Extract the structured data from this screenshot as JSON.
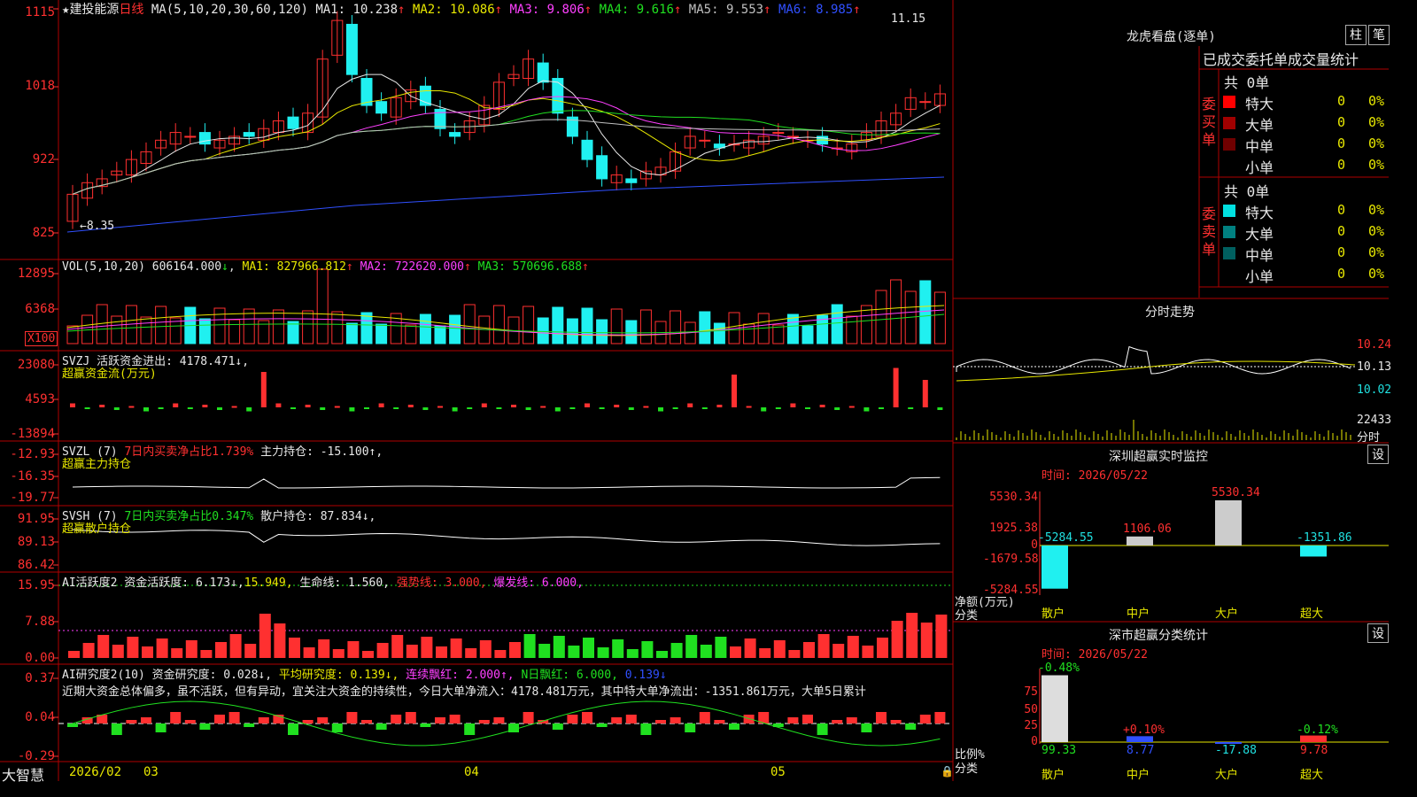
{
  "stock": {
    "name": "建投能源",
    "period": "日线",
    "star": "★"
  },
  "main": {
    "ma_params": "MA(5,10,20,30,60,120)",
    "ma_items": [
      {
        "text": "MA1: 10.238",
        "arrow": "↑",
        "color": "#e8e8e8"
      },
      {
        "text": "MA2: 10.086",
        "arrow": "↑",
        "color": "#e8e800"
      },
      {
        "text": "MA3: 9.806",
        "arrow": "↑",
        "color": "#ff40ff"
      },
      {
        "text": "MA4: 9.616",
        "arrow": "↑",
        "color": "#20e020"
      },
      {
        "text": "MA5: 9.553",
        "arrow": "↑",
        "color": "#c0c0c0"
      },
      {
        "text": "MA6: 8.985",
        "arrow": "↑",
        "color": "#3050ff"
      }
    ],
    "y_labels": [
      "1115",
      "1018",
      "922",
      "825"
    ],
    "high_mark": "11.15",
    "low_mark": "8.35"
  },
  "vol": {
    "label": "VOL(5,10,20)",
    "value": "606164.000",
    "ma_items": [
      {
        "text": "MA1: 827966.812",
        "arrow": "↑",
        "color": "#e8e800"
      },
      {
        "text": "MA2: 722620.000",
        "arrow": "↑",
        "color": "#ff40ff"
      },
      {
        "text": "MA3: 570696.688",
        "arrow": "↑",
        "color": "#20e020"
      }
    ],
    "y_labels": [
      "12895",
      "6368"
    ],
    "unit": "X100"
  },
  "svzj": {
    "line1": "SVZJ  活跃资金进出: 4178.471↓,",
    "line2": "超赢资金流(万元)",
    "y_labels": [
      "23080",
      "4593",
      "-13894"
    ]
  },
  "svzl": {
    "p1": "SVZL (7)",
    "p2": "7日内买卖净占比1.739%",
    "p3": "主力持仓: -15.100↑,",
    "line2": "超赢主力持仓",
    "y_labels": [
      "-12.93",
      "-16.35",
      "-19.77"
    ]
  },
  "svsh": {
    "p1": "SVSH (7)",
    "p2": "7日内买卖净占比0.347%",
    "p3": "散户持仓: 87.834↓,",
    "line2": "超赢散户持仓",
    "y_labels": [
      "91.95",
      "89.13",
      "86.42"
    ]
  },
  "ai_active": {
    "p1": "AI活跃度2 资金活跃度: 6.173↓,",
    "p2": "15.949,",
    "p3": "生命线: 1.560,",
    "p4": "强势线: 3.000,",
    "p5": "爆发线: 6.000,",
    "y_labels": [
      "15.95",
      "7.88",
      "0.00"
    ]
  },
  "ai_research": {
    "p1": "AI研究度2(10) 资金研究度: 0.028↓,",
    "p2": "平均研究度: 0.139↓,",
    "p3": "连续飘红: 2.000↑,",
    "p4": "N日飘红: 6.000,",
    "p5": "0.139↓",
    "comment": "近期大资金总体偏多，虽不活跃，但有异动，宜关注大资金的持续性，今日大单净流入：4178.481万元，其中特大单净流出：-1351.861万元，大单5日累计",
    "y_labels": [
      "0.37",
      "0.04",
      "-0.29"
    ]
  },
  "bottom": {
    "logo": "大智慧",
    "dates": [
      "2026/02",
      "03",
      "04",
      "05"
    ]
  },
  "right": {
    "lhkp": {
      "title": "龙虎看盘(逐单)",
      "btn_col": "柱",
      "btn_pen": "笔",
      "header": "已成交委托单成交量统计",
      "buy": {
        "side_label": "委买单",
        "total": "共 0单",
        "rows": [
          {
            "name": "特大",
            "count": "0",
            "pct": "0%",
            "color": "#ff0000"
          },
          {
            "name": "大单",
            "count": "0",
            "pct": "0%",
            "color": "#a00000"
          },
          {
            "name": "中单",
            "count": "0",
            "pct": "0%",
            "color": "#700000"
          },
          {
            "name": "小单",
            "count": "0",
            "pct": "0%",
            "color": ""
          }
        ]
      },
      "sell": {
        "side_label": "委卖单",
        "total": "共 0单",
        "rows": [
          {
            "name": "特大",
            "count": "0",
            "pct": "0%",
            "color": "#00e0e0"
          },
          {
            "name": "大单",
            "count": "0",
            "pct": "0%",
            "color": "#008080"
          },
          {
            "name": "中单",
            "count": "0",
            "pct": "0%",
            "color": "#006060"
          },
          {
            "name": "小单",
            "count": "0",
            "pct": "0%",
            "color": ""
          }
        ]
      }
    },
    "fenshi": {
      "title": "分时走势",
      "y_labels": [
        "10.24",
        "10.13",
        "10.02"
      ],
      "vol_label": "22433",
      "vol_unit": "分时"
    },
    "sz_monitor": {
      "title": "深圳超赢实时监控",
      "btn": "设",
      "time": "时间: 2026/05/22",
      "y_labels": [
        "5530.34",
        "1925.38",
        "0",
        "-1679.58",
        "-5284.55"
      ],
      "axis_label1": "净额(万元)",
      "axis_label2": "分类",
      "categories": [
        "散户",
        "中户",
        "大户",
        "超大"
      ],
      "values": [
        -5284.55,
        1106.06,
        5530.34,
        -1351.86
      ],
      "value_labels": [
        "-5284.55",
        "1106.06",
        "5530.34",
        "-1351.86"
      ]
    },
    "sz_class": {
      "title": "深市超赢分类统计",
      "btn": "设",
      "time": "时间: 2026/05/22",
      "y_labels": [
        "75",
        "50",
        "25",
        "0"
      ],
      "axis_label1": "比例%",
      "axis_label2": "分类",
      "categories": [
        "散户",
        "中户",
        "大户",
        "超大"
      ],
      "ratios": [
        99.33,
        8.77,
        -17.88,
        9.78
      ],
      "changes": [
        "-0.48%",
        "+0.10%",
        "",
        "-0.12%"
      ]
    }
  }
}
